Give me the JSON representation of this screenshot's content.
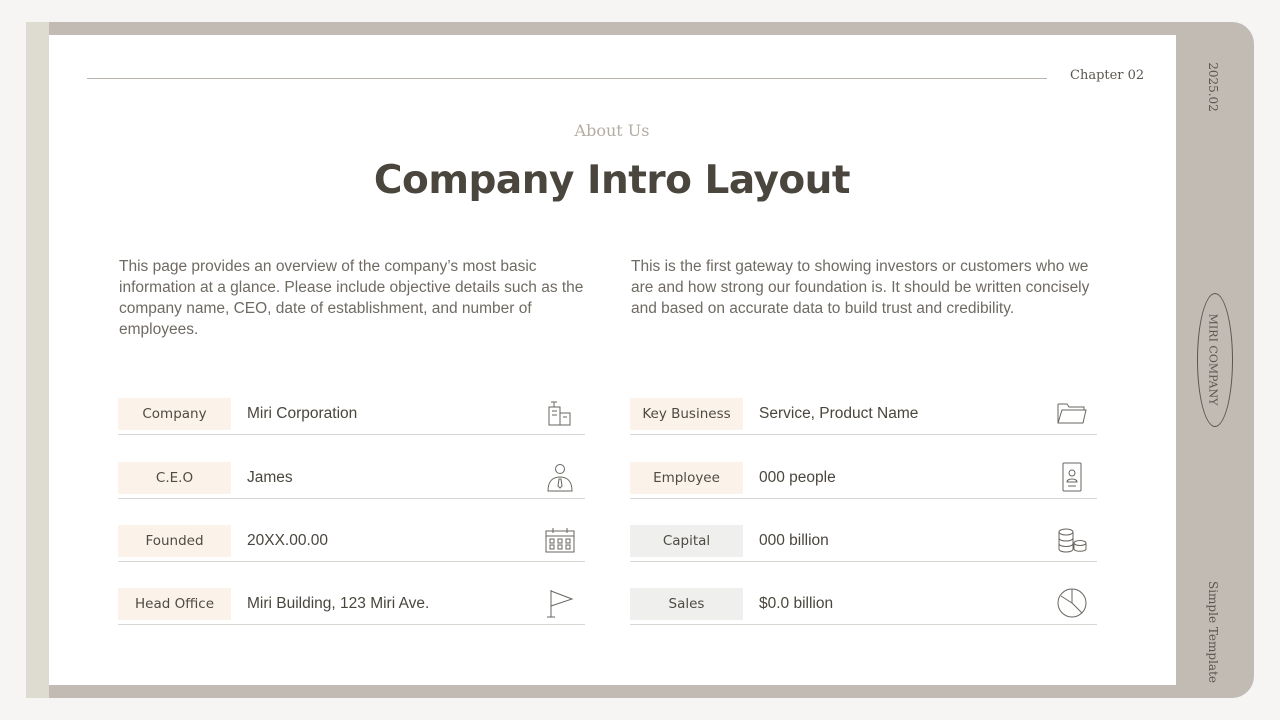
{
  "header": {
    "chapter": "Chapter 02"
  },
  "sidebar": {
    "date": "2025.02",
    "company": "MIRI COMPANY",
    "template": "Simple Template"
  },
  "main": {
    "eyebrow": "About Us",
    "title": "Company Intro Layout",
    "para_left": "This page provides an overview of the company’s most basic information at a glance. Please include objective details such as the company name, CEO, date of establishment, and number of employees.",
    "para_right": "This is the first gateway to showing investors or customers who we are and how strong our foundation is. It should be written concisely and based on accurate data to build trust and credibility."
  },
  "left_rows": [
    {
      "label": "Company",
      "value": "Miri Corporation",
      "icon": "building-icon"
    },
    {
      "label": "C.E.O",
      "value": "James",
      "icon": "person-icon"
    },
    {
      "label": "Founded",
      "value": "20XX.00.00",
      "icon": "calendar-icon"
    },
    {
      "label": "Head Office",
      "value": "Miri Building, 123 Miri Ave.",
      "icon": "flag-icon"
    }
  ],
  "right_rows": [
    {
      "label": "Key Business",
      "value": "Service, Product Name",
      "icon": "folder-icon"
    },
    {
      "label": "Employee",
      "value": "000 people",
      "icon": "id-card-icon"
    },
    {
      "label": "Capital",
      "value": "000 billion",
      "icon": "coins-icon"
    },
    {
      "label": "Sales",
      "value": "$0.0 billion",
      "icon": "pie-chart-icon"
    }
  ],
  "colors": {
    "frame": "#c1bbb4",
    "label_warm": "#fbf3ea",
    "label_gray": "#efefee",
    "title": "#4a463e"
  }
}
